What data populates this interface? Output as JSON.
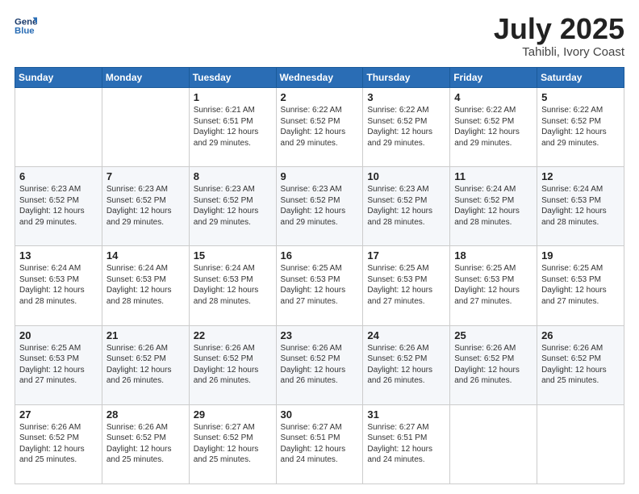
{
  "logo": {
    "line1": "General",
    "line2": "Blue"
  },
  "title": "July 2025",
  "subtitle": "Tahibli, Ivory Coast",
  "days_of_week": [
    "Sunday",
    "Monday",
    "Tuesday",
    "Wednesday",
    "Thursday",
    "Friday",
    "Saturday"
  ],
  "weeks": [
    [
      {
        "day": "",
        "sunrise": "",
        "sunset": "",
        "daylight": ""
      },
      {
        "day": "",
        "sunrise": "",
        "sunset": "",
        "daylight": ""
      },
      {
        "day": "1",
        "sunrise": "Sunrise: 6:21 AM",
        "sunset": "Sunset: 6:51 PM",
        "daylight": "Daylight: 12 hours and 29 minutes."
      },
      {
        "day": "2",
        "sunrise": "Sunrise: 6:22 AM",
        "sunset": "Sunset: 6:52 PM",
        "daylight": "Daylight: 12 hours and 29 minutes."
      },
      {
        "day": "3",
        "sunrise": "Sunrise: 6:22 AM",
        "sunset": "Sunset: 6:52 PM",
        "daylight": "Daylight: 12 hours and 29 minutes."
      },
      {
        "day": "4",
        "sunrise": "Sunrise: 6:22 AM",
        "sunset": "Sunset: 6:52 PM",
        "daylight": "Daylight: 12 hours and 29 minutes."
      },
      {
        "day": "5",
        "sunrise": "Sunrise: 6:22 AM",
        "sunset": "Sunset: 6:52 PM",
        "daylight": "Daylight: 12 hours and 29 minutes."
      }
    ],
    [
      {
        "day": "6",
        "sunrise": "Sunrise: 6:23 AM",
        "sunset": "Sunset: 6:52 PM",
        "daylight": "Daylight: 12 hours and 29 minutes."
      },
      {
        "day": "7",
        "sunrise": "Sunrise: 6:23 AM",
        "sunset": "Sunset: 6:52 PM",
        "daylight": "Daylight: 12 hours and 29 minutes."
      },
      {
        "day": "8",
        "sunrise": "Sunrise: 6:23 AM",
        "sunset": "Sunset: 6:52 PM",
        "daylight": "Daylight: 12 hours and 29 minutes."
      },
      {
        "day": "9",
        "sunrise": "Sunrise: 6:23 AM",
        "sunset": "Sunset: 6:52 PM",
        "daylight": "Daylight: 12 hours and 29 minutes."
      },
      {
        "day": "10",
        "sunrise": "Sunrise: 6:23 AM",
        "sunset": "Sunset: 6:52 PM",
        "daylight": "Daylight: 12 hours and 28 minutes."
      },
      {
        "day": "11",
        "sunrise": "Sunrise: 6:24 AM",
        "sunset": "Sunset: 6:52 PM",
        "daylight": "Daylight: 12 hours and 28 minutes."
      },
      {
        "day": "12",
        "sunrise": "Sunrise: 6:24 AM",
        "sunset": "Sunset: 6:53 PM",
        "daylight": "Daylight: 12 hours and 28 minutes."
      }
    ],
    [
      {
        "day": "13",
        "sunrise": "Sunrise: 6:24 AM",
        "sunset": "Sunset: 6:53 PM",
        "daylight": "Daylight: 12 hours and 28 minutes."
      },
      {
        "day": "14",
        "sunrise": "Sunrise: 6:24 AM",
        "sunset": "Sunset: 6:53 PM",
        "daylight": "Daylight: 12 hours and 28 minutes."
      },
      {
        "day": "15",
        "sunrise": "Sunrise: 6:24 AM",
        "sunset": "Sunset: 6:53 PM",
        "daylight": "Daylight: 12 hours and 28 minutes."
      },
      {
        "day": "16",
        "sunrise": "Sunrise: 6:25 AM",
        "sunset": "Sunset: 6:53 PM",
        "daylight": "Daylight: 12 hours and 27 minutes."
      },
      {
        "day": "17",
        "sunrise": "Sunrise: 6:25 AM",
        "sunset": "Sunset: 6:53 PM",
        "daylight": "Daylight: 12 hours and 27 minutes."
      },
      {
        "day": "18",
        "sunrise": "Sunrise: 6:25 AM",
        "sunset": "Sunset: 6:53 PM",
        "daylight": "Daylight: 12 hours and 27 minutes."
      },
      {
        "day": "19",
        "sunrise": "Sunrise: 6:25 AM",
        "sunset": "Sunset: 6:53 PM",
        "daylight": "Daylight: 12 hours and 27 minutes."
      }
    ],
    [
      {
        "day": "20",
        "sunrise": "Sunrise: 6:25 AM",
        "sunset": "Sunset: 6:53 PM",
        "daylight": "Daylight: 12 hours and 27 minutes."
      },
      {
        "day": "21",
        "sunrise": "Sunrise: 6:26 AM",
        "sunset": "Sunset: 6:52 PM",
        "daylight": "Daylight: 12 hours and 26 minutes."
      },
      {
        "day": "22",
        "sunrise": "Sunrise: 6:26 AM",
        "sunset": "Sunset: 6:52 PM",
        "daylight": "Daylight: 12 hours and 26 minutes."
      },
      {
        "day": "23",
        "sunrise": "Sunrise: 6:26 AM",
        "sunset": "Sunset: 6:52 PM",
        "daylight": "Daylight: 12 hours and 26 minutes."
      },
      {
        "day": "24",
        "sunrise": "Sunrise: 6:26 AM",
        "sunset": "Sunset: 6:52 PM",
        "daylight": "Daylight: 12 hours and 26 minutes."
      },
      {
        "day": "25",
        "sunrise": "Sunrise: 6:26 AM",
        "sunset": "Sunset: 6:52 PM",
        "daylight": "Daylight: 12 hours and 26 minutes."
      },
      {
        "day": "26",
        "sunrise": "Sunrise: 6:26 AM",
        "sunset": "Sunset: 6:52 PM",
        "daylight": "Daylight: 12 hours and 25 minutes."
      }
    ],
    [
      {
        "day": "27",
        "sunrise": "Sunrise: 6:26 AM",
        "sunset": "Sunset: 6:52 PM",
        "daylight": "Daylight: 12 hours and 25 minutes."
      },
      {
        "day": "28",
        "sunrise": "Sunrise: 6:26 AM",
        "sunset": "Sunset: 6:52 PM",
        "daylight": "Daylight: 12 hours and 25 minutes."
      },
      {
        "day": "29",
        "sunrise": "Sunrise: 6:27 AM",
        "sunset": "Sunset: 6:52 PM",
        "daylight": "Daylight: 12 hours and 25 minutes."
      },
      {
        "day": "30",
        "sunrise": "Sunrise: 6:27 AM",
        "sunset": "Sunset: 6:51 PM",
        "daylight": "Daylight: 12 hours and 24 minutes."
      },
      {
        "day": "31",
        "sunrise": "Sunrise: 6:27 AM",
        "sunset": "Sunset: 6:51 PM",
        "daylight": "Daylight: 12 hours and 24 minutes."
      },
      {
        "day": "",
        "sunrise": "",
        "sunset": "",
        "daylight": ""
      },
      {
        "day": "",
        "sunrise": "",
        "sunset": "",
        "daylight": ""
      }
    ]
  ]
}
